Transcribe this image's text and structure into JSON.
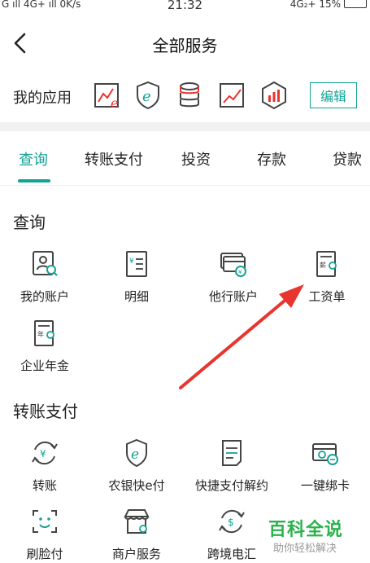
{
  "status_bar": {
    "left": "G ıll 4G+ ıll 0K/s",
    "time": "21:32",
    "right": "4G₂+ 15%"
  },
  "nav": {
    "title": "全部服务"
  },
  "my_apps": {
    "label": "我的应用",
    "edit_label": "编辑"
  },
  "tabs": [
    {
      "label": "查询",
      "active": true
    },
    {
      "label": "转账支付"
    },
    {
      "label": "投资"
    },
    {
      "label": "存款"
    },
    {
      "label": "贷款"
    }
  ],
  "sections": {
    "query": {
      "title": "查询",
      "items": [
        {
          "label": "我的账户",
          "icon": "account-search-icon"
        },
        {
          "label": "明细",
          "icon": "detail-list-icon"
        },
        {
          "label": "他行账户",
          "icon": "other-bank-card-icon"
        },
        {
          "label": "工资单",
          "icon": "salary-slip-icon"
        },
        {
          "label": "企业年金",
          "icon": "annuity-icon"
        }
      ]
    },
    "transfer": {
      "title": "转账支付",
      "items": [
        {
          "label": "转账",
          "icon": "transfer-icon"
        },
        {
          "label": "农银快e付",
          "icon": "quick-epay-icon"
        },
        {
          "label": "快捷支付解约",
          "icon": "quick-pay-cancel-icon"
        },
        {
          "label": "一键绑卡",
          "icon": "bind-card-icon"
        },
        {
          "label": "刷脸付",
          "icon": "face-pay-icon"
        },
        {
          "label": "商户服务",
          "icon": "merchant-icon"
        },
        {
          "label": "跨境电汇",
          "icon": "cross-border-icon"
        }
      ]
    }
  },
  "watermark": {
    "main": "百科全说",
    "sub": "助你轻松解决"
  },
  "colors": {
    "accent": "#13a394",
    "arrow": "#e8352f",
    "watermark": "#2bb24c"
  }
}
